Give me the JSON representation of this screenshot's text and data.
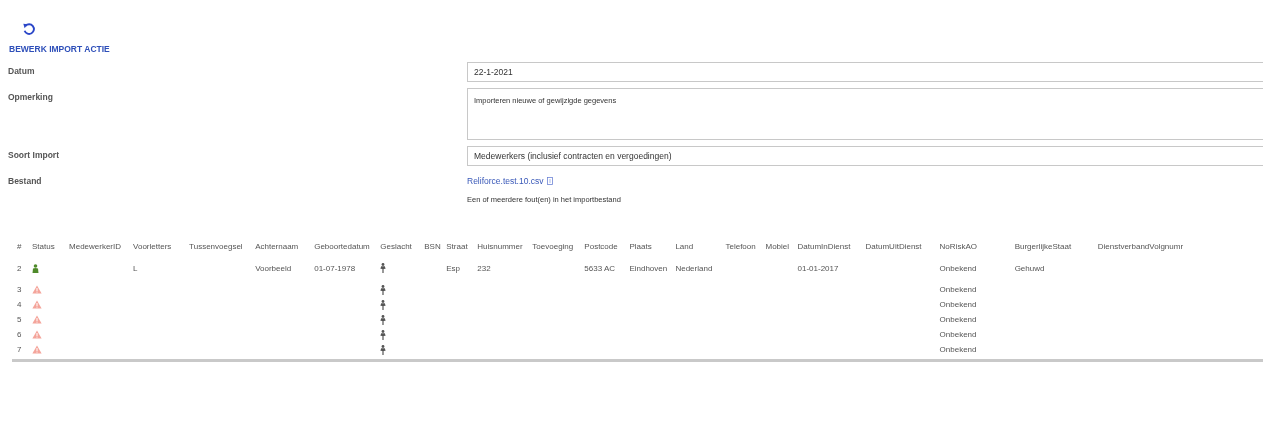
{
  "title": "BEWERK IMPORT ACTIE",
  "form": [
    {
      "label": "Datum",
      "kind": "input",
      "value": "22-1-2021"
    },
    {
      "label": "Opmerking",
      "kind": "textarea",
      "value": "Importeren nieuwe of gewijzigde gegevens"
    },
    {
      "label": "Soort Import",
      "kind": "input",
      "value": "Medewerkers (inclusief contracten en vergoedingen)"
    },
    {
      "label": "Bestand",
      "kind": "file",
      "value": "Reliforce.test.10.csv",
      "error": "Een of meerdere fout(en) in het importbestand"
    }
  ],
  "table": {
    "columns": [
      "#",
      "Status",
      "MedewerkerID",
      "Voorletters",
      "Tussenvoegsel",
      "Achternaam",
      "Geboortedatum",
      "Geslacht",
      "BSN",
      "Straat",
      "Huisnummer",
      "Toevoeging",
      "Postcode",
      "Plaats",
      "Land",
      "Telefoon",
      "Mobiel",
      "DatumInDienst",
      "DatumUitDienst",
      "NoRiskAO",
      "BurgerlijkeStaat",
      "DienstverbandVolgnumr"
    ],
    "rows": [
      {
        "number": "2",
        "kind": "ok",
        "voorletters": "L",
        "achternaam": "Voorbeeld",
        "geboortedatum": "01-07-1978",
        "straat": "Esp",
        "huisnummer": "232",
        "postcode": "5633 AC",
        "plaats": "Eindhoven",
        "land": "Nederland",
        "datumindienst": "01-01-2017",
        "noriskao": "Onbekend",
        "burgerlijkestaat": "Gehuwd"
      },
      {
        "number": "3",
        "kind": "error",
        "noriskao": "Onbekend"
      },
      {
        "number": "4",
        "kind": "error",
        "noriskao": "Onbekend"
      },
      {
        "number": "5",
        "kind": "error",
        "noriskao": "Onbekend"
      },
      {
        "number": "6",
        "kind": "error",
        "noriskao": "Onbekend"
      },
      {
        "number": "7",
        "kind": "error",
        "noriskao": "Onbekend"
      }
    ]
  }
}
